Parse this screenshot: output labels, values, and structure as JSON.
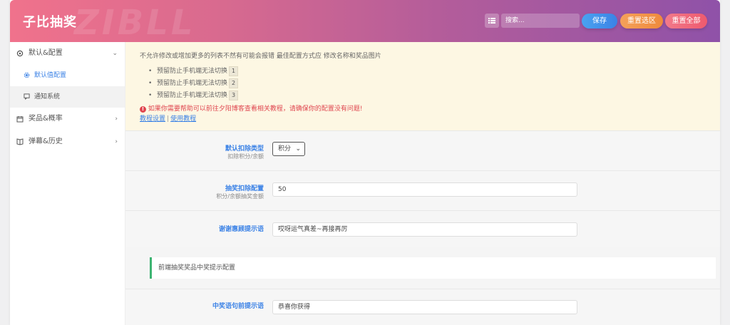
{
  "header": {
    "brand": "子比抽奖",
    "watermark": "ZIBLL",
    "search_placeholder": "搜索...",
    "save_label": "保存",
    "reset_section_label": "重置选区",
    "reset_all_label": "重置全部"
  },
  "sidebar": {
    "items": [
      {
        "label": "默认&配置",
        "icon": "gear-icon"
      },
      {
        "label": "奖品&概率",
        "icon": "calendar-icon"
      },
      {
        "label": "弹幕&历史",
        "icon": "book-icon"
      }
    ],
    "sub_items": [
      {
        "label": "默认值配置",
        "icon": "gear-icon"
      },
      {
        "label": "通知系统",
        "icon": "message-icon"
      }
    ]
  },
  "notice": {
    "line1": "不允许修改或增加更多的列表不然有可能会报错 最佳配置方式应 修改名称和奖品图片",
    "bullets": [
      {
        "text": "预留防止手机端无法切换",
        "num": "1"
      },
      {
        "text": "预留防止手机端无法切换",
        "num": "2"
      },
      {
        "text": "预留防止手机端无法切换",
        "num": "3"
      }
    ],
    "warning": "如果你需要帮助可以前往夕阳博客查看相关教程，请确保你的配置没有问题!",
    "link1": "教程设置",
    "link_sep": "|",
    "link2": "使用教程"
  },
  "fields": {
    "deduct_type": {
      "label": "默认扣除类型",
      "sub": "扣除积分/余额",
      "value": "积分"
    },
    "deduct_config": {
      "label": "抽奖扣除配置",
      "sub": "积分/余额抽奖金额",
      "value": "50"
    },
    "thanks_tip": {
      "label": "谢谢惠顾提示语",
      "value": "哎呀运气真差~再接再厉"
    },
    "section_title": "前端抽奖奖品中奖提示配置",
    "win_prefix": {
      "label": "中奖语句前提示语",
      "value": "恭喜你获得"
    }
  }
}
